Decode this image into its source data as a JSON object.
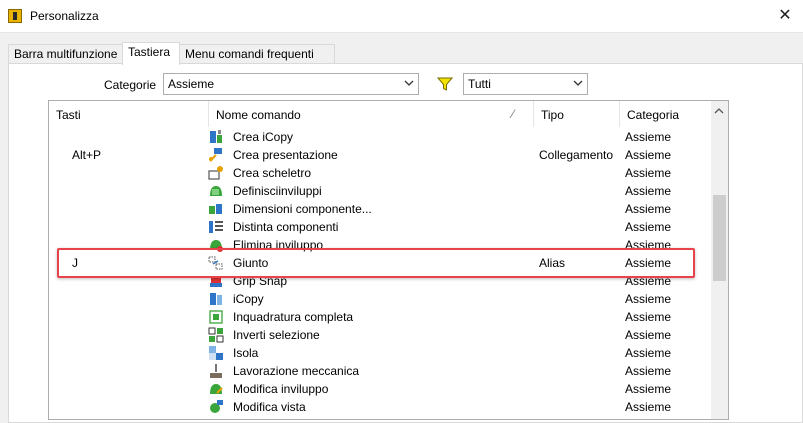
{
  "window": {
    "title": "Personalizza",
    "close_glyph": "✕"
  },
  "tabs": [
    {
      "label": "Barra multifunzione",
      "active": false
    },
    {
      "label": "Tastiera",
      "active": true
    },
    {
      "label": "Menu comandi frequenti",
      "active": false
    }
  ],
  "filters": {
    "category_label": "Categorie",
    "category_value": "Assieme",
    "filter_icon": "funnel-icon",
    "type_value": "Tutti"
  },
  "table": {
    "columns": [
      "Tasti",
      "Nome comando",
      "Tipo",
      "Categoria"
    ],
    "rows": [
      {
        "key": "",
        "name": "Crea iCopy",
        "type": "",
        "category": "Assieme",
        "icon": "icopy-create-icon"
      },
      {
        "key": "Alt+P",
        "name": "Crea presentazione",
        "type": "Collegamento",
        "category": "Assieme",
        "icon": "presentation-icon"
      },
      {
        "key": "",
        "name": "Crea scheletro",
        "type": "",
        "category": "Assieme",
        "icon": "skeleton-icon"
      },
      {
        "key": "",
        "name": "Definisciinviluppi",
        "type": "",
        "category": "Assieme",
        "icon": "envelope-define-icon"
      },
      {
        "key": "",
        "name": "Dimensioni componente...",
        "type": "",
        "category": "Assieme",
        "icon": "component-size-icon"
      },
      {
        "key": "",
        "name": "Distinta componenti",
        "type": "",
        "category": "Assieme",
        "icon": "bom-icon"
      },
      {
        "key": "",
        "name": "Elimina inviluppo",
        "type": "",
        "category": "Assieme",
        "icon": "envelope-delete-icon"
      },
      {
        "key": "J",
        "name": "Giunto",
        "type": "Alias",
        "category": "Assieme",
        "icon": "joint-icon"
      },
      {
        "key": "",
        "name": "Grip Snap",
        "type": "",
        "category": "Assieme",
        "icon": "grip-snap-icon"
      },
      {
        "key": "",
        "name": "iCopy",
        "type": "",
        "category": "Assieme",
        "icon": "icopy-icon"
      },
      {
        "key": "",
        "name": "Inquadratura completa",
        "type": "",
        "category": "Assieme",
        "icon": "zoom-all-icon"
      },
      {
        "key": "",
        "name": "Inverti selezione",
        "type": "",
        "category": "Assieme",
        "icon": "invert-selection-icon"
      },
      {
        "key": "",
        "name": "Isola",
        "type": "",
        "category": "Assieme",
        "icon": "isolate-icon"
      },
      {
        "key": "",
        "name": "Lavorazione meccanica",
        "type": "",
        "category": "Assieme",
        "icon": "machining-icon"
      },
      {
        "key": "",
        "name": "Modifica inviluppo",
        "type": "",
        "category": "Assieme",
        "icon": "envelope-edit-icon"
      },
      {
        "key": "",
        "name": "Modifica vista",
        "type": "",
        "category": "Assieme",
        "icon": "edit-view-icon"
      }
    ]
  },
  "colors": {
    "highlight": "#e8424c",
    "accent_green": "#3aa53a",
    "accent_blue": "#2e75c9"
  }
}
